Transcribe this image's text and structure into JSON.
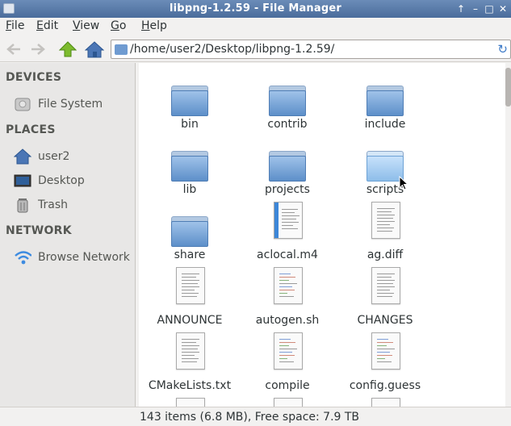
{
  "window": {
    "title": "libpng-1.2.59 - File Manager"
  },
  "menu": [
    {
      "label": "File",
      "underline": "F",
      "rest": "ile"
    },
    {
      "label": "Edit",
      "underline": "E",
      "rest": "dit"
    },
    {
      "label": "View",
      "underline": "V",
      "rest": "iew"
    },
    {
      "label": "Go",
      "underline": "G",
      "rest": "o"
    },
    {
      "label": "Help",
      "underline": "H",
      "rest": "elp"
    }
  ],
  "toolbar": {
    "back_icon": "back-arrow-icon",
    "forward_icon": "forward-arrow-icon",
    "up_icon": "up-arrow-icon",
    "home_icon": "home-icon",
    "path": "/home/user2/Desktop/libpng-1.2.59/",
    "reload_icon": "reload-icon"
  },
  "sidebar": {
    "devices_header": "DEVICES",
    "devices": [
      {
        "label": "File System",
        "icon": "harddisk-icon"
      }
    ],
    "places_header": "PLACES",
    "places": [
      {
        "label": "user2",
        "icon": "home-icon"
      },
      {
        "label": "Desktop",
        "icon": "desktop-icon"
      },
      {
        "label": "Trash",
        "icon": "trash-icon"
      }
    ],
    "network_header": "NETWORK",
    "network": [
      {
        "label": "Browse Network",
        "icon": "wifi-icon"
      }
    ]
  },
  "files": [
    {
      "name": "bin",
      "kind": "folder"
    },
    {
      "name": "contrib",
      "kind": "folder"
    },
    {
      "name": "include",
      "kind": "folder"
    },
    {
      "name": "lib",
      "kind": "folder"
    },
    {
      "name": "projects",
      "kind": "folder"
    },
    {
      "name": "scripts",
      "kind": "folder"
    },
    {
      "name": "share",
      "kind": "folder"
    },
    {
      "name": "aclocal.m4",
      "kind": "m4"
    },
    {
      "name": "ag.diff",
      "kind": "text"
    },
    {
      "name": "ANNOUNCE",
      "kind": "text"
    },
    {
      "name": "autogen.sh",
      "kind": "code"
    },
    {
      "name": "CHANGES",
      "kind": "text"
    },
    {
      "name": "CMakeLists.txt",
      "kind": "text"
    },
    {
      "name": "compile",
      "kind": "code"
    },
    {
      "name": "config.guess",
      "kind": "code"
    }
  ],
  "status": {
    "text": "143 items (6.8 MB), Free space: 7.9 TB"
  },
  "colors": {
    "titlebar": "#4a6c9b",
    "folder": "#5d8fc9",
    "accent": "#3d7ac7"
  }
}
